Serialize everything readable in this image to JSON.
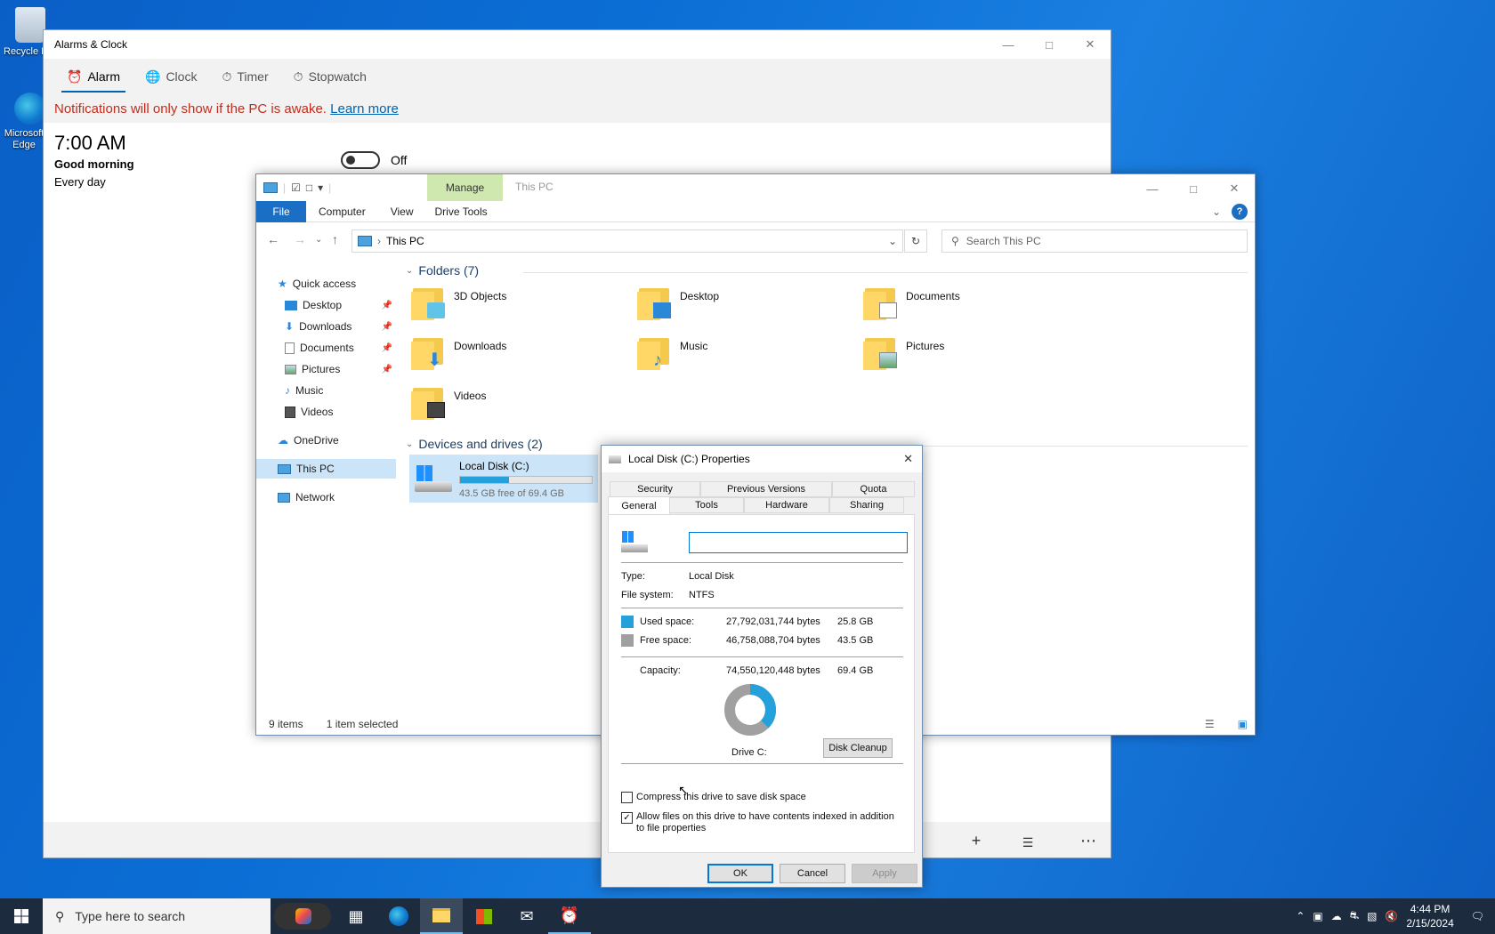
{
  "desktop": {
    "icons": [
      {
        "label": "Recycle Bin"
      },
      {
        "label": "Microsoft Edge"
      }
    ]
  },
  "alarms": {
    "title": "Alarms & Clock",
    "tabs": [
      {
        "label": "Alarm",
        "icon": "alarm-icon"
      },
      {
        "label": "Clock",
        "icon": "globe-icon"
      },
      {
        "label": "Timer",
        "icon": "timer-icon"
      },
      {
        "label": "Stopwatch",
        "icon": "stopwatch-icon"
      }
    ],
    "notice": "Notifications will only show if the PC is awake.",
    "learn_more": "Learn more",
    "alarm": {
      "time": "7:00 AM",
      "name": "Good morning",
      "repeat": "Every day",
      "state": "Off"
    }
  },
  "explorer": {
    "title": "This PC",
    "manage_label": "Manage",
    "ribbon_tabs": [
      "File",
      "Computer",
      "View",
      "Drive Tools"
    ],
    "address": "This PC",
    "search_placeholder": "Search This PC",
    "nav": {
      "quick_access": "Quick access",
      "items": [
        {
          "label": "Desktop",
          "pinned": true
        },
        {
          "label": "Downloads",
          "pinned": true
        },
        {
          "label": "Documents",
          "pinned": true
        },
        {
          "label": "Pictures",
          "pinned": true
        },
        {
          "label": "Music",
          "pinned": false
        },
        {
          "label": "Videos",
          "pinned": false
        }
      ],
      "onedrive": "OneDrive",
      "this_pc": "This PC",
      "network": "Network"
    },
    "folders_header": "Folders (7)",
    "folders": [
      "3D Objects",
      "Desktop",
      "Documents",
      "Downloads",
      "Music",
      "Pictures",
      "Videos"
    ],
    "devices_header": "Devices and drives (2)",
    "drive": {
      "name": "Local Disk (C:)",
      "free_text": "43.5 GB free of 69.4 GB",
      "used_fraction": 0.373
    },
    "status": {
      "items": "9 items",
      "selected": "1 item selected"
    }
  },
  "props": {
    "title": "Local Disk (C:) Properties",
    "tabs_top": [
      "Security",
      "Previous Versions",
      "Quota"
    ],
    "tabs_bottom": [
      "General",
      "Tools",
      "Hardware",
      "Sharing"
    ],
    "name_value": "",
    "type_label": "Type:",
    "type_value": "Local Disk",
    "fs_label": "File system:",
    "fs_value": "NTFS",
    "used_label": "Used space:",
    "used_bytes": "27,792,031,744 bytes",
    "used_gb": "25.8 GB",
    "free_label": "Free space:",
    "free_bytes": "46,758,088,704 bytes",
    "free_gb": "43.5 GB",
    "cap_label": "Capacity:",
    "cap_bytes": "74,550,120,448 bytes",
    "cap_gb": "69.4 GB",
    "drive_label": "Drive C:",
    "cleanup": "Disk Cleanup",
    "compress": "Compress this drive to save disk space",
    "compress_checked": false,
    "index": "Allow files on this drive to have contents indexed in addition to file properties",
    "index_checked": true,
    "ok": "OK",
    "cancel": "Cancel",
    "apply": "Apply",
    "used_fraction": 0.373,
    "colors": {
      "used": "#26a0da",
      "free": "#a0a0a0"
    }
  },
  "taskbar": {
    "search_placeholder": "Type here to search",
    "time": "4:44 PM",
    "date": "2/15/2024"
  }
}
